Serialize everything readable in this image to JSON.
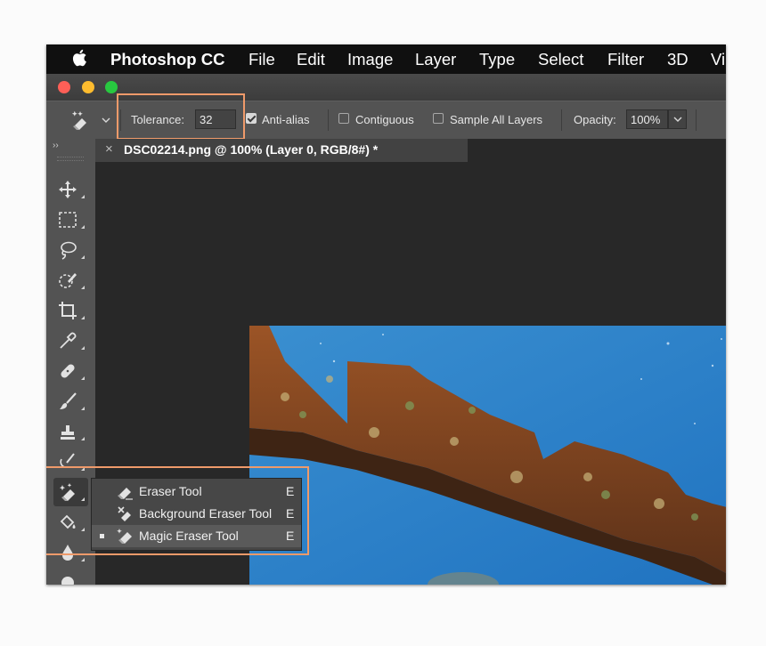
{
  "menubar": {
    "app_name": "Photoshop CC",
    "items": [
      "File",
      "Edit",
      "Image",
      "Layer",
      "Type",
      "Select",
      "Filter",
      "3D",
      "Vi"
    ]
  },
  "window_controls": {
    "close_color": "#fe5f57",
    "minimize_color": "#febc2e",
    "zoom_color": "#28c840"
  },
  "options_bar": {
    "tool_icon": "magic-eraser-icon",
    "tolerance_label": "Tolerance:",
    "tolerance_value": "32",
    "anti_alias_label": "Anti-alias",
    "anti_alias_checked": true,
    "contiguous_label": "Contiguous",
    "contiguous_checked": false,
    "sample_all_layers_label": "Sample All Layers",
    "sample_all_layers_checked": false,
    "opacity_label": "Opacity:",
    "opacity_value": "100%"
  },
  "document_tab": {
    "close_glyph": "×",
    "title": "DSC02214.png @ 100% (Layer 0, RGB/8#) *"
  },
  "toolbar": {
    "collapse_glyph": "››",
    "tools": [
      "move-icon",
      "marquee-icon",
      "lasso-icon",
      "quick-selection-icon",
      "crop-icon",
      "eyedropper-icon",
      "healing-brush-icon",
      "brush-icon",
      "clone-stamp-icon",
      "history-brush-icon",
      "magic-eraser-icon",
      "paint-bucket-icon",
      "blur-icon",
      "dodge-icon"
    ]
  },
  "flyout": {
    "items": [
      {
        "label": "Eraser Tool",
        "shortcut": "E",
        "icon": "eraser-icon",
        "selected": false
      },
      {
        "label": "Background Eraser Tool",
        "shortcut": "E",
        "icon": "background-eraser-icon",
        "selected": false
      },
      {
        "label": "Magic Eraser Tool",
        "shortcut": "E",
        "icon": "magic-eraser-icon",
        "selected": true
      }
    ]
  },
  "highlight_color": "#ef9a6a"
}
